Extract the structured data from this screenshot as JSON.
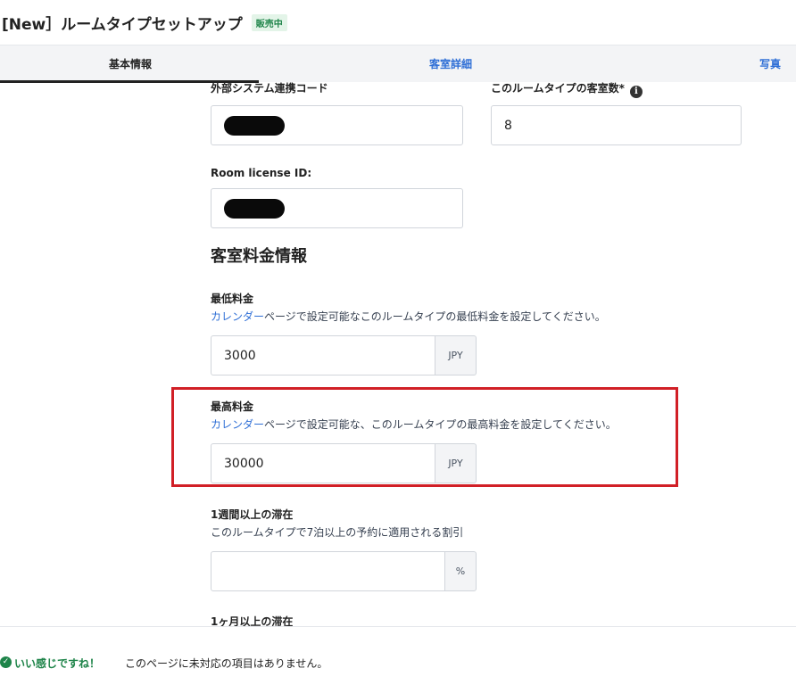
{
  "header": {
    "title": "[New］ルームタイプセットアップ",
    "badge": "販売中"
  },
  "tabs": [
    {
      "label": "基本情報",
      "active": true
    },
    {
      "label": "客室詳細",
      "active": false
    },
    {
      "label": "写真",
      "active": false
    }
  ],
  "fields": {
    "external_code": {
      "label": "外部システム連携コード",
      "value": ""
    },
    "room_count": {
      "label": "このルームタイプの客室数*",
      "value": "8"
    },
    "license_id": {
      "label": "Room license ID:",
      "value": ""
    }
  },
  "pricing": {
    "section_title": "客室料金情報",
    "min_rate": {
      "label": "最低料金",
      "link": "カレンダー",
      "help": "ページで設定可能なこのルームタイプの最低料金を設定してください。",
      "value": "3000",
      "currency": "JPY"
    },
    "max_rate": {
      "label": "最高料金",
      "link": "カレンダー",
      "help": "ページで設定可能な、このルームタイプの最高料金を設定してください。",
      "value": "30000",
      "currency": "JPY"
    },
    "weekly_stay": {
      "label": "1週間以上の滞在",
      "help": "このルームタイプで7泊以上の予約に適用される割引",
      "value": "",
      "unit": "%"
    },
    "monthly_stay": {
      "label": "1ヶ月以上の滞在"
    }
  },
  "footer": {
    "ok": "いい感じですね！",
    "message": "このページに未対応の項目はありません。"
  },
  "colors": {
    "accent_link": "#2f6fd6",
    "success": "#1e8449",
    "highlight_border": "#d11f26"
  }
}
